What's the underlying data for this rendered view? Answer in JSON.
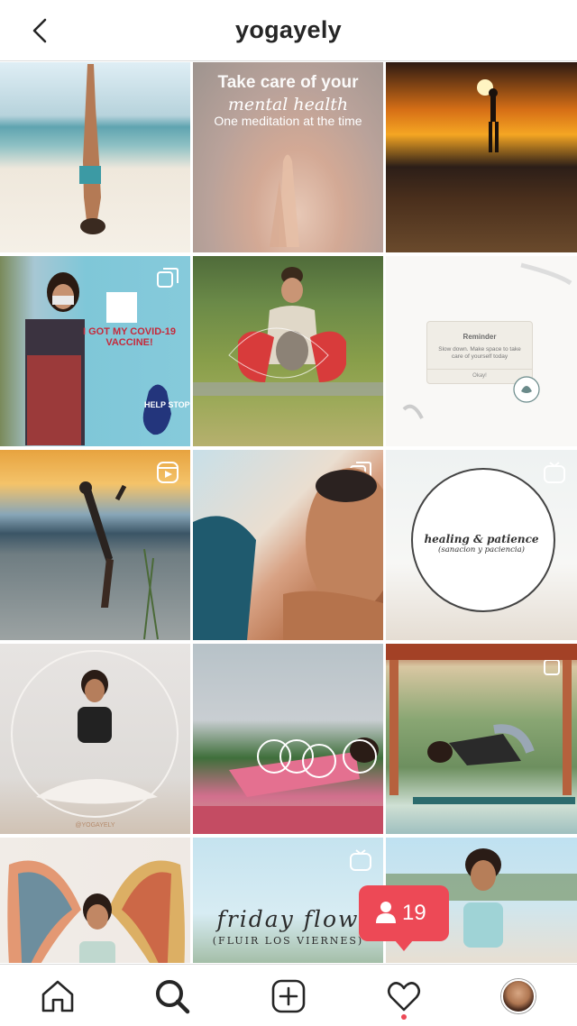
{
  "header": {
    "title": "yogayely",
    "back_icon": "chevron-left-icon"
  },
  "posts": [
    {
      "id": "p1",
      "kind": "photo"
    },
    {
      "id": "p2",
      "kind": "photo",
      "caption": [
        "Take care of your",
        "mental health",
        "One meditation at the time"
      ]
    },
    {
      "id": "p3",
      "kind": "photo"
    },
    {
      "id": "p4",
      "kind": "carousel",
      "caption": [
        "I GOT MY COVID-19 VACCINE!",
        "HELP STOP"
      ]
    },
    {
      "id": "p5",
      "kind": "photo"
    },
    {
      "id": "p6",
      "kind": "photo",
      "reminder": {
        "title": "Reminder",
        "body": "Slow down. Make space to take care of yourself today",
        "ok": "Okay!"
      }
    },
    {
      "id": "p7",
      "kind": "reel"
    },
    {
      "id": "p8",
      "kind": "carousel"
    },
    {
      "id": "p9",
      "kind": "igtv",
      "caption": [
        "healing & patience",
        "(sanacion y paciencia)"
      ]
    },
    {
      "id": "p10",
      "kind": "photo",
      "caption": [
        "@YOGAYELY"
      ]
    },
    {
      "id": "p11",
      "kind": "photo"
    },
    {
      "id": "p12",
      "kind": "carousel"
    },
    {
      "id": "p13",
      "kind": "photo"
    },
    {
      "id": "p14",
      "kind": "igtv",
      "caption": [
        "friday flow",
        "(FLUIR LOS VIERNES)"
      ]
    },
    {
      "id": "p15",
      "kind": "photo"
    }
  ],
  "activity": {
    "follow_count": "19",
    "icon": "person-icon",
    "color": "#ed4956"
  },
  "nav": {
    "items": [
      "home-icon",
      "search-icon",
      "new-post-icon",
      "activity-heart-icon",
      "profile-avatar"
    ],
    "active": "search-icon"
  }
}
